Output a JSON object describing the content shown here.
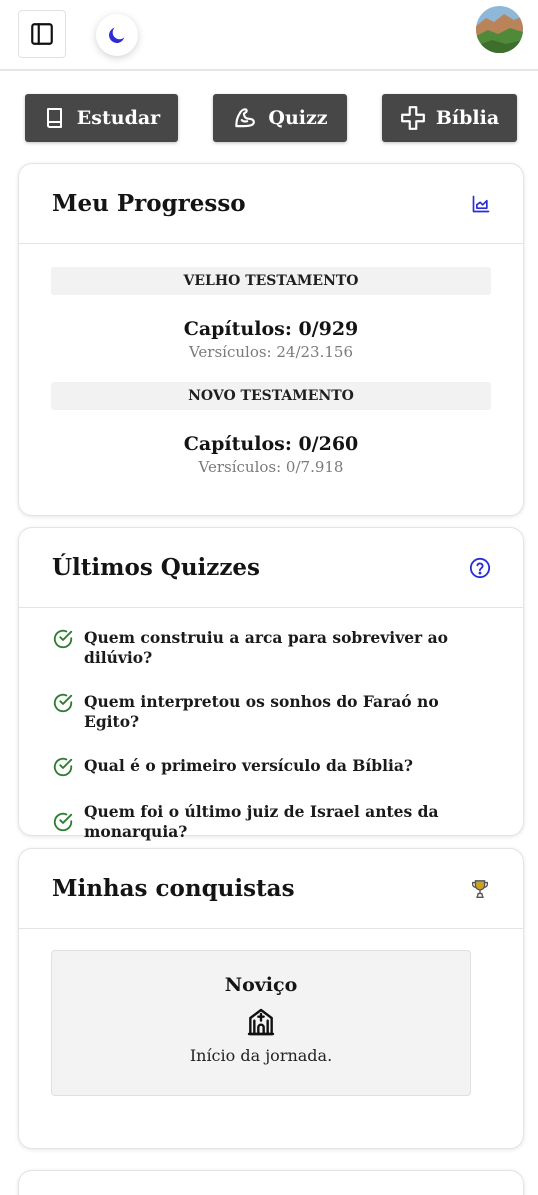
{
  "header": {
    "sidebar_toggle_icon": "sidebar-toggle-icon",
    "theme_icon": "moon-icon",
    "accent": "#2b2bd9"
  },
  "actions": [
    {
      "label": "Estudar",
      "icon": "book-icon"
    },
    {
      "label": "Quizz",
      "icon": "flex-arm-icon"
    },
    {
      "label": "Bíblia",
      "icon": "plus-icon"
    }
  ],
  "progress": {
    "title": "Meu Progresso",
    "icon": "chart-icon",
    "old_testament": {
      "label": "VELHO TESTAMENTO",
      "chapters": "Capítulos: 0/929",
      "verses": "Versículos: 24/23.156"
    },
    "new_testament": {
      "label": "NOVO TESTAMENTO",
      "chapters": "Capítulos: 0/260",
      "verses": "Versículos: 0/7.918"
    }
  },
  "quizzes": {
    "title": "Últimos Quizzes",
    "icon": "help-circle-icon",
    "check_color": "#2e7d32",
    "items": [
      "Quem construiu a arca para sobreviver ao dilúvio?",
      "Quem interpretou os sonhos do Faraó no Egito?",
      "Qual é o primeiro versículo da Bíblia?",
      "Quem foi o último juiz de Israel antes da monarquia?"
    ]
  },
  "achievements": {
    "title": "Minhas conquistas",
    "icon": "trophy-icon",
    "items": [
      {
        "name": "Noviço",
        "icon": "church-icon",
        "description": "Início da jornada."
      }
    ]
  }
}
